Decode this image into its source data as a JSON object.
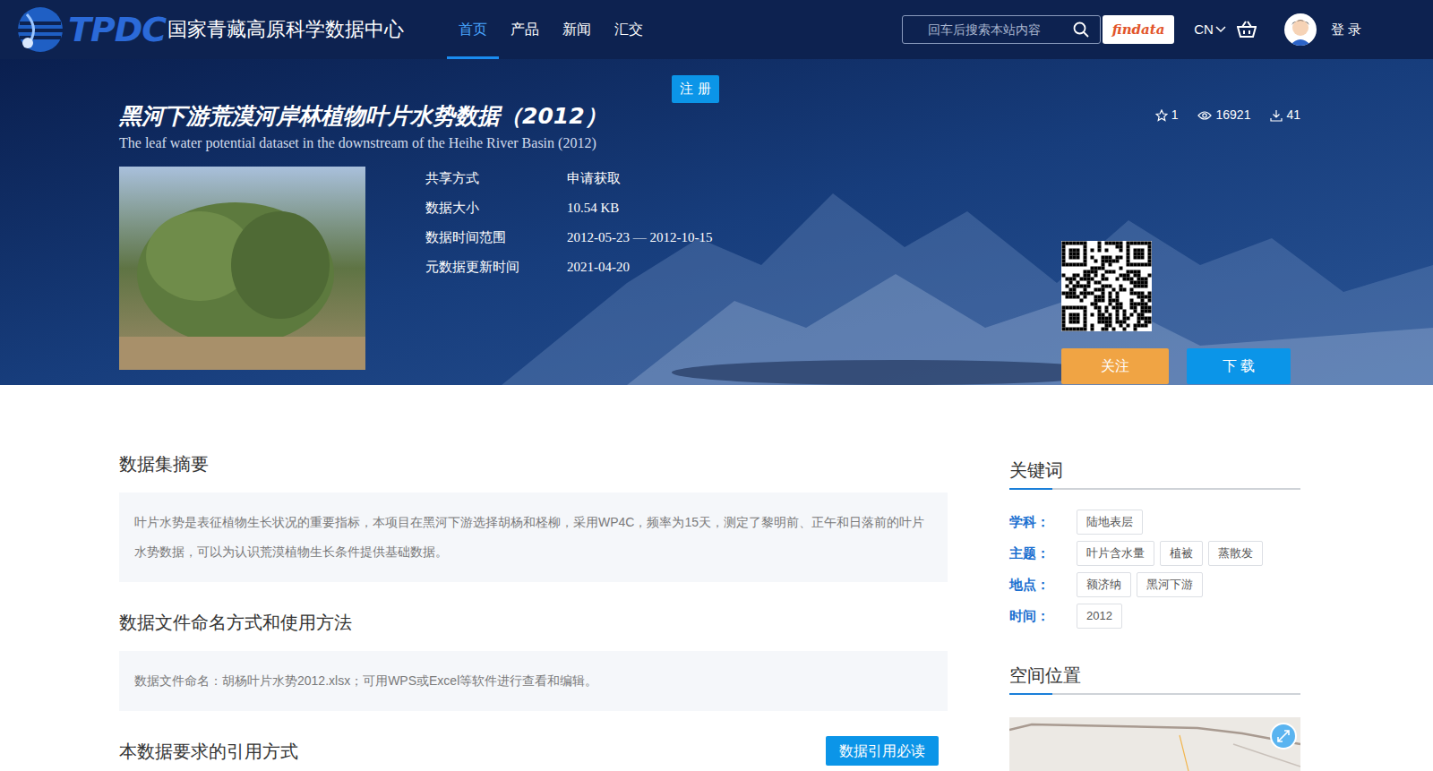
{
  "logo": {
    "abbr": "TPDC",
    "name": "国家青藏高原科学数据中心"
  },
  "nav": [
    {
      "label": "首页",
      "selected": true
    },
    {
      "label": "产品",
      "selected": false
    },
    {
      "label": "新闻",
      "selected": false
    },
    {
      "label": "汇交",
      "selected": false
    }
  ],
  "search": {
    "placeholder": "回车后搜索本站内容"
  },
  "findata": "findata",
  "language": "CN",
  "login": "登 录",
  "register": "注 册",
  "dataset": {
    "title": "黑河下游荒漠河岸林植物叶片水势数据（2012）",
    "subtitle": "The leaf water potential dataset in the downstream of the Heihe River Basin (2012)"
  },
  "stats": {
    "favorites": "1",
    "views": "16921",
    "downloads": "41"
  },
  "info": [
    {
      "label": "共享方式",
      "value": "申请获取"
    },
    {
      "label": "数据大小",
      "value": "10.54 KB"
    },
    {
      "label": "数据时间范围",
      "value": "2012-05-23 — 2012-10-15"
    },
    {
      "label": "元数据更新时间",
      "value": "2021-04-20"
    }
  ],
  "actions": {
    "follow": "关注",
    "download": "下 载"
  },
  "sections": [
    {
      "heading": "数据集摘要",
      "body": "叶片水势是表征植物生长状况的重要指标，本项目在黑河下游选择胡杨和柽柳，采用WP4C，频率为15天，测定了黎明前、正午和日落前的叶片水势数据，可以为认识荒漠植物生长条件提供基础数据。"
    },
    {
      "heading": "数据文件命名方式和使用方法",
      "body": "数据文件命名：胡杨叶片水势2012.xlsx；可用WPS或Excel等软件进行查看和编辑。"
    }
  ],
  "citation": {
    "heading": "本数据要求的引用方式",
    "button": "数据引用必读"
  },
  "keywords": {
    "heading": "关键词",
    "groups": [
      {
        "label": "学科：",
        "tags": [
          "陆地表层"
        ]
      },
      {
        "label": "主题：",
        "tags": [
          "叶片含水量",
          "植被",
          "蒸散发"
        ]
      },
      {
        "label": "地点：",
        "tags": [
          "额济纳",
          "黑河下游"
        ]
      },
      {
        "label": "时间：",
        "tags": [
          "2012"
        ]
      }
    ]
  },
  "spatial": {
    "heading": "空间位置"
  }
}
